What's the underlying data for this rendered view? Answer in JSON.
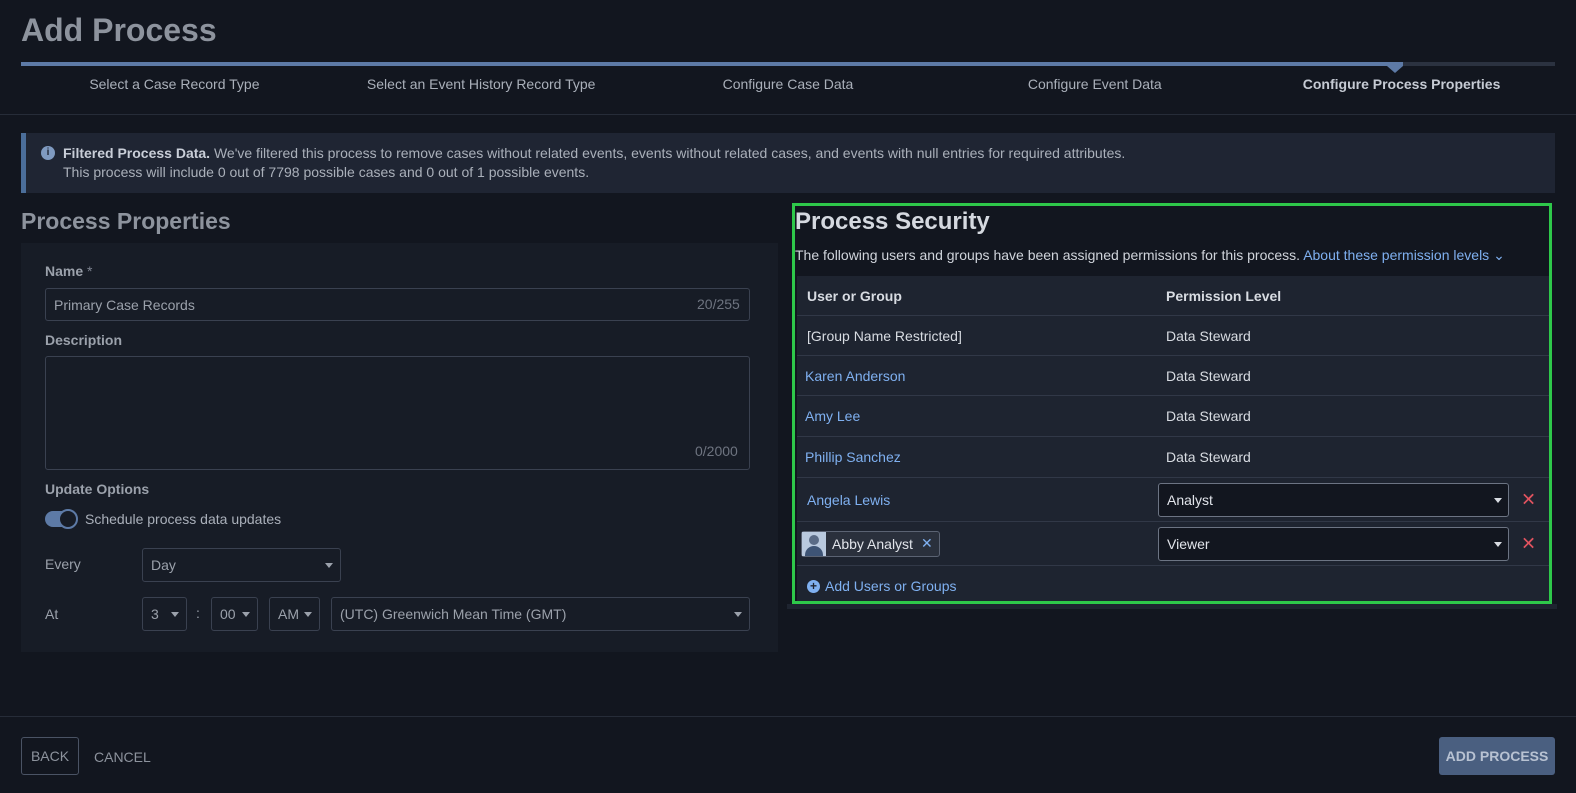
{
  "page": {
    "title": "Add Process"
  },
  "stepper": {
    "steps": [
      "Select a Case Record Type",
      "Select an Event History Record Type",
      "Configure Case Data",
      "Configure Event Data",
      "Configure Process Properties"
    ],
    "active_index": 4
  },
  "banner": {
    "title": "Filtered Process Data.",
    "line1": "We've filtered this process to remove cases without related events, events without related cases, and events with null entries for required attributes.",
    "line2": "This process will include 0 out of 7798 possible cases and 0 out of 1 possible events."
  },
  "properties": {
    "heading": "Process Properties",
    "name_label": "Name",
    "required_mark": "*",
    "name_value": "Primary Case Records",
    "name_counter": "20/255",
    "description_label": "Description",
    "description_value": "",
    "description_counter": "0/2000",
    "update_options_label": "Update Options",
    "schedule_toggle_label": "Schedule process data updates",
    "schedule_enabled": true,
    "every_label": "Every",
    "every_value": "Day",
    "at_label": "At",
    "hour_value": "3",
    "time_separator": ":",
    "minute_value": "00",
    "ampm_value": "AM",
    "timezone_value": "(UTC) Greenwich Mean Time (GMT)"
  },
  "security": {
    "heading": "Process Security",
    "description": "The following users and groups have been assigned permissions for this process.",
    "about_link": "About these permission levels",
    "about_chevron": "⌄",
    "col_user": "User or Group",
    "col_permission": "Permission Level",
    "rows": [
      {
        "name": "[Group Name Restricted]",
        "permission": "Data Steward"
      },
      {
        "name": "Karen Anderson",
        "permission": "Data Steward"
      },
      {
        "name": "Amy Lee",
        "permission": "Data Steward"
      },
      {
        "name": "Phillip Sanchez",
        "permission": "Data Steward"
      },
      {
        "name": "Angela Lewis",
        "permission": "Analyst"
      },
      {
        "name": "Abby Analyst",
        "permission": "Viewer"
      }
    ],
    "remove_glyph": "✕",
    "chip_remove_glyph": "✕",
    "add_label": "Add Users or Groups",
    "add_glyph": "+"
  },
  "footer": {
    "back": "BACK",
    "cancel": "CANCEL",
    "add": "ADD PROCESS"
  },
  "colors": {
    "background": "#12161f",
    "accent": "#5d7aa6",
    "link": "#7fb0f0",
    "highlight": "#2ec84a",
    "danger": "#e0535f"
  }
}
